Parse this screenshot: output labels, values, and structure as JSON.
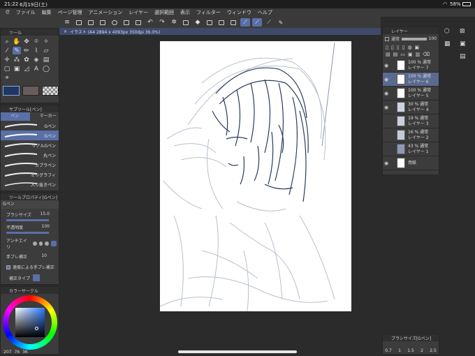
{
  "status": {
    "time": "21:22",
    "date": "6月19日(土)",
    "battery": "58%"
  },
  "menu": [
    "ファイル",
    "編集",
    "ページ管理",
    "アニメーション",
    "レイヤー",
    "選択範囲",
    "表示",
    "フィルター",
    "ウィンドウ",
    "ヘルプ"
  ],
  "tool_panel": {
    "title": "ツール"
  },
  "subtool_panel": {
    "title": "サブツール[ペン]",
    "tabs": [
      "ペン",
      "マーカー"
    ],
    "brushes": [
      "Gペン",
      "Gペン",
      "リアルGペン",
      "丸ペン",
      "カブラペン",
      "ミリグラフィ",
      "入り抜きペン"
    ],
    "selected": 1
  },
  "tool_property": {
    "title": "ツールプロパティ[Gペン]",
    "tool_name": "Gペン",
    "brush_size_label": "ブラシサイズ",
    "brush_size": "15.0",
    "opacity_label": "不透明度",
    "opacity": "100",
    "antialias_label": "アンチエイリ",
    "stabilization_label": "手ブレ補正",
    "stabilization": "10",
    "speed_stab_label": "速度による手ブレ補正",
    "correction_label": "補正タイプ"
  },
  "color_panel": {
    "title": "カラーサークル",
    "h": "207",
    "s": "76",
    "v": "36"
  },
  "document_tab": "イラスト (A4 2894 x 4093px 350dpi 36.0%)",
  "layer_panel": {
    "title": "レイヤー",
    "blend": "通常",
    "opacity": "100",
    "layers": [
      {
        "opacity": "100 %",
        "mode": "通常",
        "name": "レイヤー 7",
        "selected": false
      },
      {
        "opacity": "100 %",
        "mode": "通常",
        "name": "レイヤー 6",
        "selected": true
      },
      {
        "opacity": "100 %",
        "mode": "通常",
        "name": "レイヤー 5",
        "selected": false
      },
      {
        "opacity": "30 %",
        "mode": "通常",
        "name": "レイヤー 4",
        "selected": false
      },
      {
        "opacity": "19 %",
        "mode": "通常",
        "name": "レイヤー 3",
        "selected": false
      },
      {
        "opacity": "16 %",
        "mode": "通常",
        "name": "レイヤー 2",
        "selected": false
      },
      {
        "opacity": "43 %",
        "mode": "通常",
        "name": "レイヤー 1",
        "selected": false
      },
      {
        "opacity": "",
        "mode": "",
        "name": "用紙",
        "selected": false
      }
    ]
  },
  "brush_size_panel": {
    "title": "ブラシサイズ[Gペン]",
    "sizes": [
      "0.7",
      "1",
      "1.5",
      "2",
      "2.5"
    ]
  }
}
